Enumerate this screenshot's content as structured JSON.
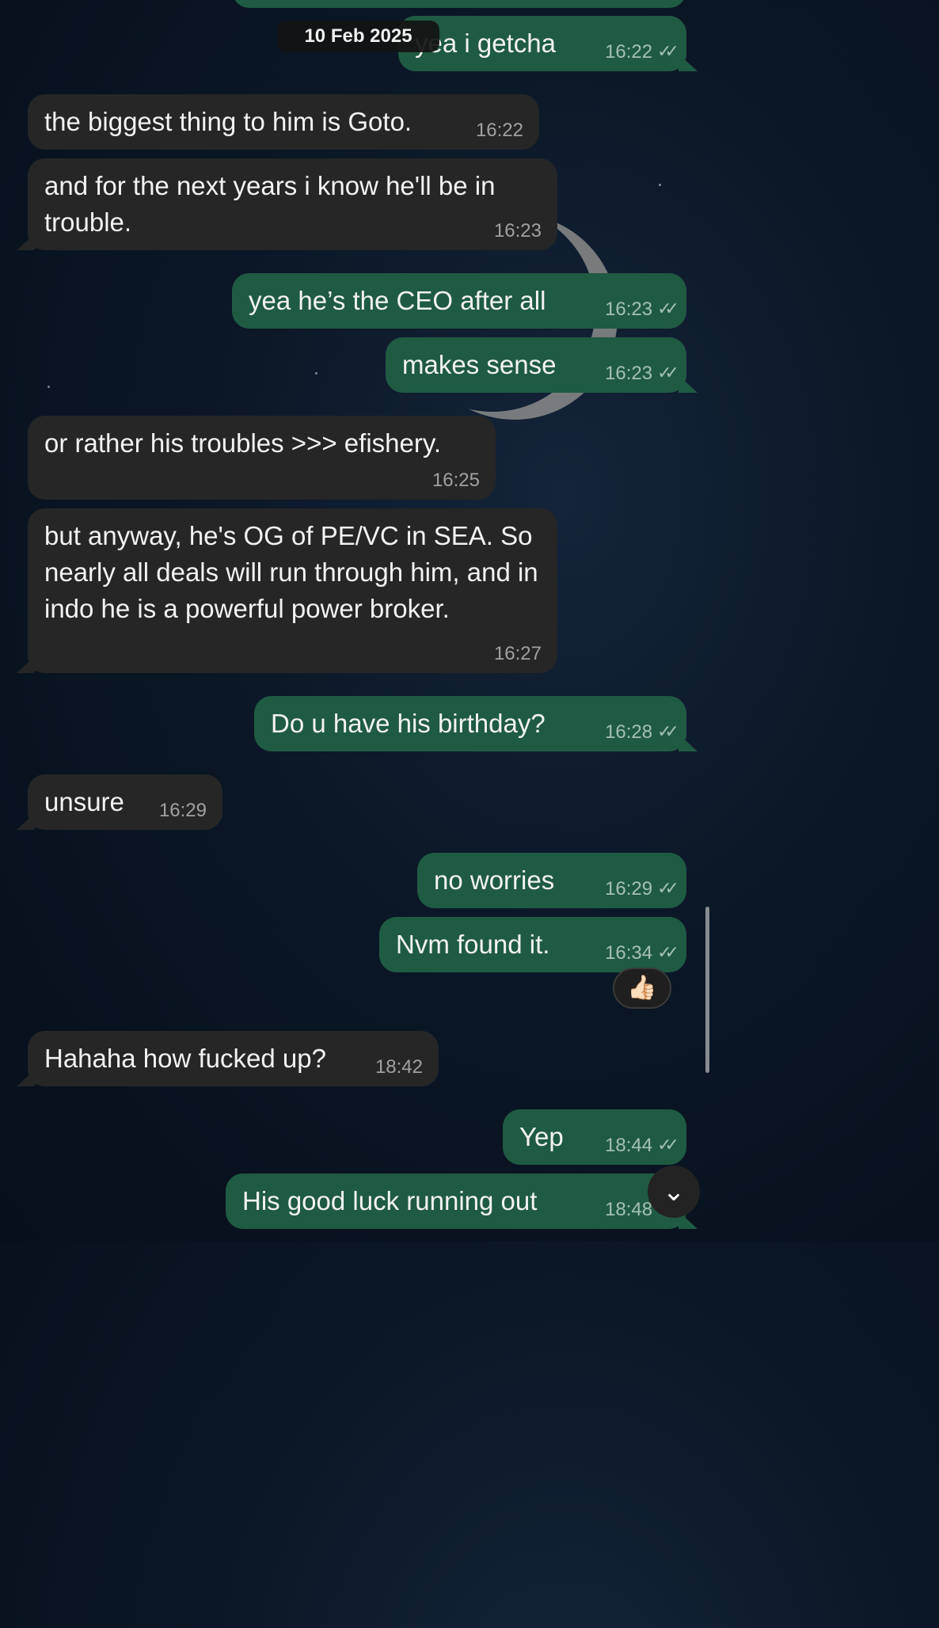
{
  "date_chip": "10 Feb 2025",
  "read_ticks": "✓✓",
  "reaction_emoji": "👍🏻",
  "scroll_down_glyph": "⌄",
  "messages": [
    {
      "dir": "out",
      "text": "yea i getcha",
      "time": "16:22"
    },
    {
      "dir": "in",
      "text": "the biggest thing to him is Goto.",
      "time": "16:22"
    },
    {
      "dir": "in",
      "text": "and for the next years i know he'll be in trouble.",
      "time": "16:23"
    },
    {
      "dir": "out",
      "text": "yea he’s the CEO after all",
      "time": "16:23"
    },
    {
      "dir": "out",
      "text": "makes sense",
      "time": "16:23"
    },
    {
      "dir": "in",
      "text": "or rather his troubles >>> efishery.",
      "time": "16:25"
    },
    {
      "dir": "in",
      "text": "but anyway, he's OG of PE/VC in SEA. So nearly all deals will run through him, and in indo he is a powerful power broker.",
      "time": "16:27"
    },
    {
      "dir": "out",
      "text": "Do u have his birthday?",
      "time": "16:28"
    },
    {
      "dir": "in",
      "text": "unsure",
      "time": "16:29"
    },
    {
      "dir": "out",
      "text": "no worries",
      "time": "16:29"
    },
    {
      "dir": "out",
      "text": "Nvm found it.",
      "time": "16:34"
    },
    {
      "dir": "in",
      "text": "Hahaha how fucked up?",
      "time": "18:42"
    },
    {
      "dir": "out",
      "text": "Yep",
      "time": "18:44"
    },
    {
      "dir": "out",
      "text": "His good luck running out",
      "time": "18:48"
    }
  ]
}
